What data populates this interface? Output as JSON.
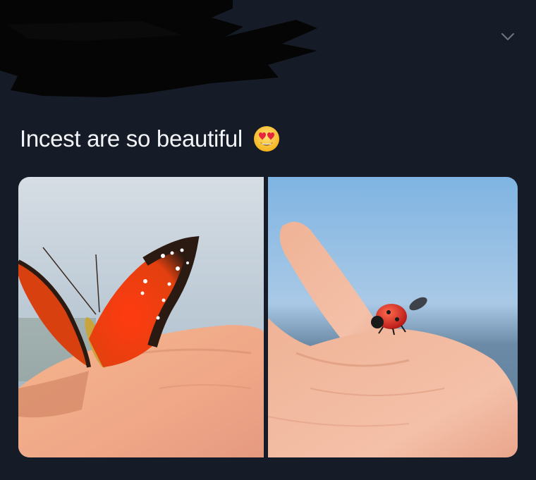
{
  "tweet": {
    "text": "Incest are so beautiful",
    "emoji": "smiling-face-with-heart-eyes",
    "menu_icon": "chevron-down-icon"
  },
  "media": {
    "photos": [
      {
        "subject": "butterfly-on-hand"
      },
      {
        "subject": "ladybug-on-finger"
      }
    ]
  },
  "colors": {
    "background": "#161c27",
    "text": "#f2f4f7",
    "redaction": "#050505"
  }
}
